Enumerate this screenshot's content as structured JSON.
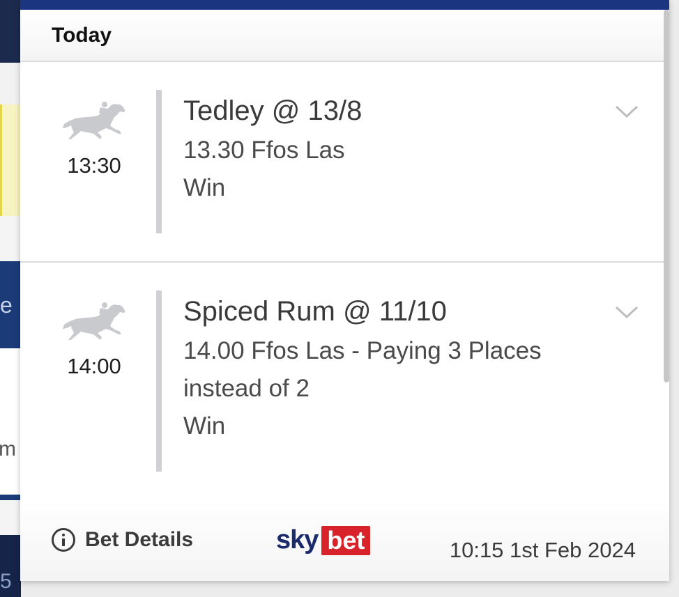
{
  "header": {
    "title": "Today"
  },
  "selections": [
    {
      "icon": "horse-racing-icon",
      "time": "13:30",
      "title": "Tedley @ 13/8",
      "race": "13.30 Ffos Las",
      "market": "Win"
    },
    {
      "icon": "horse-racing-icon",
      "time": "14:00",
      "title": "Spiced Rum @ 11/10",
      "race": "14.00 Ffos Las - Paying 3 Places instead of 2",
      "market": "Win"
    }
  ],
  "footer": {
    "bet_details_label": "Bet Details",
    "logo_sky": "sky",
    "logo_bet": "bet",
    "timestamp": "10:15 1st Feb 2024"
  },
  "background": {
    "left_edge_letters": [
      "e",
      "m",
      "5"
    ]
  },
  "colors": {
    "brand_navy": "#1b3580",
    "brand_red": "#d8232a",
    "text_dark": "#3b3b3b",
    "divider_grey": "#cfcfd4"
  }
}
